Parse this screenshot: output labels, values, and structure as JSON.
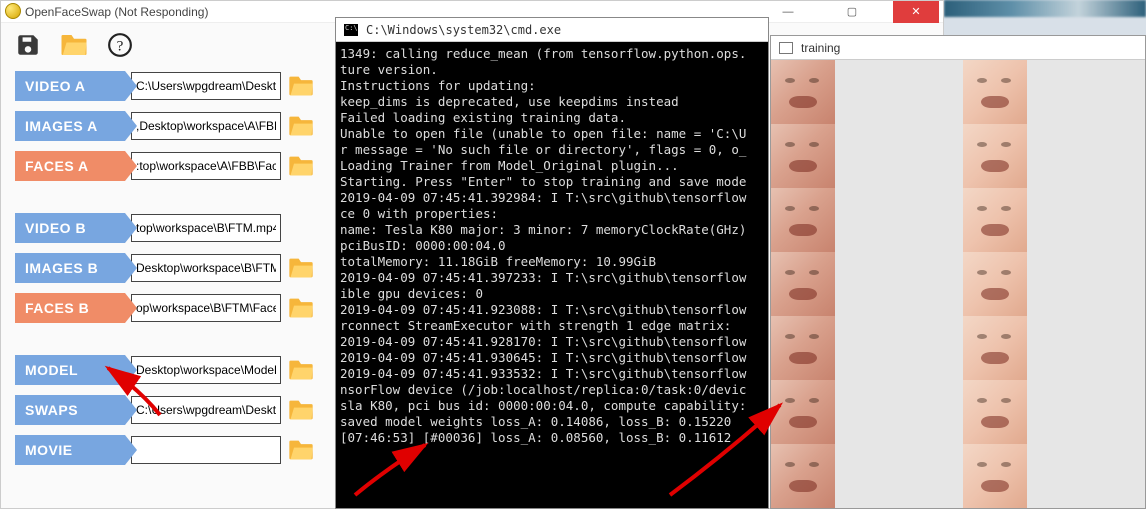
{
  "app": {
    "title": "OpenFaceSwap (Not Responding)",
    "win_min": "—",
    "win_max": "▢",
    "win_close": "✕",
    "rows": [
      {
        "label": "VIDEO A",
        "color": "blue",
        "value": "C:\\Users\\wpgdream\\Deskto",
        "browse": true
      },
      {
        "label": "IMAGES A",
        "color": "blue",
        "value": ",Desktop\\workspace\\A\\FBB",
        "browse": true
      },
      {
        "label": "FACES A",
        "color": "orange",
        "value": ":top\\workspace\\A\\FBB\\Face",
        "browse": true
      },
      {
        "spacer": true
      },
      {
        "label": "VIDEO B",
        "color": "blue",
        "value": "top\\workspace\\B\\FTM.mp4",
        "browse": false
      },
      {
        "label": "IMAGES B",
        "color": "blue",
        "value": "Desktop\\workspace\\B\\FTM",
        "browse": true
      },
      {
        "label": "FACES B",
        "color": "orange",
        "value": "op\\workspace\\B\\FTM\\Face",
        "browse": true
      },
      {
        "spacer": true
      },
      {
        "label": "MODEL",
        "color": "blue",
        "value": "Desktop\\workspace\\Model",
        "browse": true
      },
      {
        "label": "SWAPS",
        "color": "blue",
        "value": "C:\\Users\\wpgdream\\Deskto",
        "browse": true
      },
      {
        "label": "MOVIE",
        "color": "blue",
        "value": "",
        "browse": true
      }
    ]
  },
  "cmd": {
    "title": "C:\\Windows\\system32\\cmd.exe",
    "lines": [
      "1349: calling reduce_mean (from tensorflow.python.ops.",
      "ture version.",
      "Instructions for updating:",
      "keep_dims is deprecated, use keepdims instead",
      "Failed loading existing training data.",
      "Unable to open file (unable to open file: name = 'C:\\U",
      "r message = 'No such file or directory', flags = 0, o_",
      "Loading Trainer from Model_Original plugin...",
      "Starting. Press \"Enter\" to stop training and save mode",
      "2019-04-09 07:45:41.392984: I T:\\src\\github\\tensorflow",
      "ce 0 with properties:",
      "name: Tesla K80 major: 3 minor: 7 memoryClockRate(GHz)",
      "pciBusID: 0000:00:04.0",
      "totalMemory: 11.18GiB freeMemory: 10.99GiB",
      "2019-04-09 07:45:41.397233: I T:\\src\\github\\tensorflow",
      "ible gpu devices: 0",
      "2019-04-09 07:45:41.923088: I T:\\src\\github\\tensorflow",
      "rconnect StreamExecutor with strength 1 edge matrix:",
      "2019-04-09 07:45:41.928170: I T:\\src\\github\\tensorflow",
      "2019-04-09 07:45:41.930645: I T:\\src\\github\\tensorflow",
      "2019-04-09 07:45:41.933532: I T:\\src\\github\\tensorflow",
      "nsorFlow device (/job:localhost/replica:0/task:0/devic",
      "sla K80, pci bus id: 0000:00:04.0, compute capability:",
      "saved model weights loss_A: 0.14086, loss_B: 0.15220",
      "[07:46:53] [#00036] loss_A: 0.08560, loss_B: 0.11612"
    ]
  },
  "training": {
    "title": "training",
    "pairs": 7
  }
}
